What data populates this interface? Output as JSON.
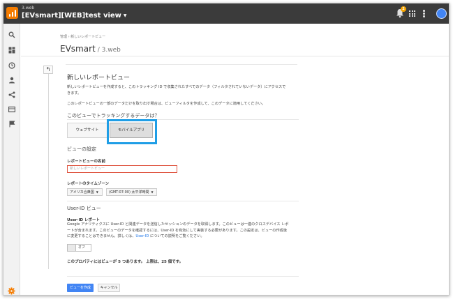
{
  "header": {
    "account": "3.web",
    "property": "[EVsmart][WEB]test view",
    "notification_count": "2"
  },
  "breadcrumb": "管理 › 新しいレポートビュー",
  "page": {
    "title": "EVsmart",
    "subtitle": "/ 3.web"
  },
  "form": {
    "title": "新しいレポートビュー",
    "intro1": "新しいレポートビューを作成すると、このトラッキング ID で収集されたすべてのデータ（フィルタされていないデータ）にアクセスできます。",
    "intro2": "このレポートビューの一部のデータだけを取り出す場合は、ビューフィルタを作成して、このデータに適用してください。",
    "track_question": "このビューでトラッキングするデータは？",
    "option_website": "ウェブサイト",
    "option_mobile": "モバイルアプリ",
    "settings_heading": "ビューの設定",
    "name_label": "レポートビューの名前",
    "name_placeholder": "新しいレポートビュー",
    "timezone_label": "レポートのタイムゾーン",
    "country": "アメリカ合衆国",
    "timezone": "(GMT-07:00) 太平洋時間",
    "userid_heading": "User-ID ビュー",
    "userid_label": "User-ID レポート",
    "userid_desc_pre": "Google アナリティクスに User-ID と関連データを送信したセッションのデータを取得します。このビューは一連のクロスデバイス レポートが含まれます。このビューのデータを確認するには、User-ID を有効にして実装する必要があります。この設定は、ビューの作成後に変更することはできません。詳しくは、",
    "userid_link": "User-ID",
    "userid_desc_post": " についての説明をご覧ください。",
    "toggle_label": "オフ",
    "count_note": "このプロパティにはビューが 5 つあります。 上限は、25 個です。",
    "create_button": "ビューを作成",
    "cancel_button": "キャンセル"
  },
  "colors": {
    "topbar": "#3b3b3b",
    "accent": "#4285f4",
    "highlight": "#1f9ee6",
    "error": "#e05a46",
    "logo": "#f57c00"
  },
  "icons": [
    "analytics-logo-icon",
    "bell-icon",
    "apps-grid-icon",
    "more-vert-icon",
    "avatar-icon",
    "search-icon",
    "dashboard-icon",
    "clock-icon",
    "person-icon",
    "share-icon",
    "display-icon",
    "flag-icon",
    "gear-icon",
    "back-arrow-icon"
  ]
}
